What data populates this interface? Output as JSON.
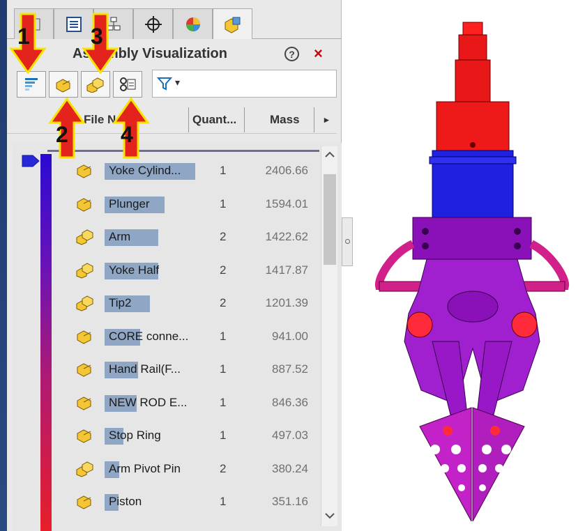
{
  "panel": {
    "title": "Assembly Visualization",
    "help_label": "?",
    "close_label": "×",
    "tabs": [
      "feature-manager",
      "property-manager",
      "configuration-manager",
      "dimxpert-manager",
      "display-manager",
      "assembly-visualization"
    ],
    "filter_caret": "▾"
  },
  "columns": {
    "file_name": "File Name",
    "quantity": "Quant...",
    "mass": "Mass",
    "more": "▸"
  },
  "callouts": [
    "1",
    "2",
    "3",
    "4"
  ],
  "rows": [
    {
      "name": "Yoke Cylind...",
      "qty": "1",
      "mass": "2406.66",
      "type": "part",
      "bar": 1.0
    },
    {
      "name": "Plunger",
      "qty": "1",
      "mass": "1594.01",
      "type": "part",
      "bar": 0.66
    },
    {
      "name": "Arm",
      "qty": "2",
      "mass": "1422.62",
      "type": "multi",
      "bar": 0.59
    },
    {
      "name": "Yoke Half",
      "qty": "2",
      "mass": "1417.87",
      "type": "multi",
      "bar": 0.59
    },
    {
      "name": "Tip2",
      "qty": "2",
      "mass": "1201.39",
      "type": "multi",
      "bar": 0.5
    },
    {
      "name": "CORE conne...",
      "qty": "1",
      "mass": "941.00",
      "type": "part",
      "bar": 0.39
    },
    {
      "name": "Hand Rail(F...",
      "qty": "1",
      "mass": "887.52",
      "type": "part",
      "bar": 0.37
    },
    {
      "name": "NEW ROD E...",
      "qty": "1",
      "mass": "846.36",
      "type": "part",
      "bar": 0.35
    },
    {
      "name": "Stop Ring",
      "qty": "1",
      "mass": "497.03",
      "type": "part",
      "bar": 0.21
    },
    {
      "name": "Arm Pivot Pin",
      "qty": "2",
      "mass": "380.24",
      "type": "multi",
      "bar": 0.16
    },
    {
      "name": "Piston",
      "qty": "1",
      "mass": "351.16",
      "type": "part",
      "bar": 0.15
    }
  ],
  "colors": {
    "callout_arrow": "#e4231d",
    "callout_outline": "#f7e400",
    "bar": "#8fa6c4",
    "gradient_top": "#2a0ad2",
    "gradient_bottom": "#e81e2a"
  }
}
